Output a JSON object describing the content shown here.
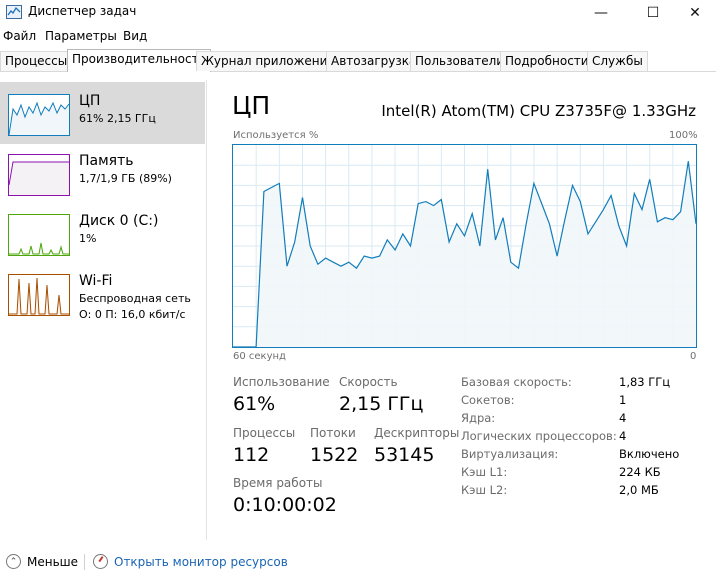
{
  "window": {
    "title": "Диспетчер задач",
    "minimize": "—",
    "maximize": "☐",
    "close": "✕"
  },
  "menu": [
    "Файл",
    "Параметры",
    "Вид"
  ],
  "tabs": [
    "Процессы",
    "Производительность",
    "Журнал приложений",
    "Автозагрузка",
    "Пользователи",
    "Подробности",
    "Службы"
  ],
  "active_tab": "Производительность",
  "sidebar": [
    {
      "title": "ЦП",
      "line1": "61% 2,15 ГГц",
      "line2": "",
      "color": "#117dbb"
    },
    {
      "title": "Память",
      "line1": "1,7/1,9 ГБ (89%)",
      "line2": "",
      "color": "#8b12ae"
    },
    {
      "title": "Диск 0 (C:)",
      "line1": "1%",
      "line2": "",
      "color": "#4da60c"
    },
    {
      "title": "Wi-Fi",
      "line1": "Беспроводная сеть",
      "line2": "О: 0 П: 16,0 кбит/с",
      "color": "#a74f01"
    }
  ],
  "main": {
    "title": "ЦП",
    "cpu_name": "Intel(R) Atom(TM) CPU Z3735F@ 1.33GHz",
    "chart_label_left": "Используется %",
    "chart_label_right": "100%",
    "axis_left": "60 секунд",
    "axis_right": "0"
  },
  "chart_data": {
    "type": "area",
    "title": "",
    "ylabel": "Используется %",
    "ymax_label": "100%",
    "xlabel_left": "60 секунд",
    "xlabel_right": "0",
    "ylim": [
      0,
      100
    ],
    "x_seconds_ago": [
      60,
      57,
      56,
      54,
      53,
      52,
      51,
      50,
      49,
      48,
      47,
      46,
      45,
      44,
      43,
      42,
      41,
      40,
      39,
      38,
      37,
      36,
      35,
      34,
      33,
      32,
      31,
      30,
      29,
      28,
      27,
      26,
      25,
      24,
      23,
      22,
      21,
      20,
      19,
      18,
      17,
      16,
      15,
      14,
      13,
      12,
      11,
      10,
      9,
      8,
      7,
      6,
      5,
      4,
      3,
      2,
      1,
      0
    ],
    "values": [
      0,
      0,
      77,
      81,
      40,
      52,
      74,
      50,
      41,
      44,
      42,
      40,
      42,
      39,
      45,
      44,
      45,
      53,
      48,
      56,
      50,
      71,
      72,
      70,
      73,
      52,
      61,
      55,
      66,
      50,
      88,
      53,
      64,
      42,
      39,
      61,
      81,
      71,
      61,
      45,
      63,
      80,
      72,
      56,
      62,
      68,
      75,
      60,
      50,
      76,
      68,
      83,
      62,
      64,
      63,
      67,
      92,
      61
    ],
    "color": "#117dbb",
    "fill": "#f1f6fa"
  },
  "stats": {
    "usage_label": "Использование",
    "usage_value": "61%",
    "speed_label": "Скорость",
    "speed_value": "2,15 ГГц",
    "processes_label": "Процессы",
    "processes_value": "112",
    "threads_label": "Потоки",
    "threads_value": "1522",
    "handles_label": "Дескрипторы",
    "handles_value": "53145",
    "uptime_label": "Время работы",
    "uptime_value": "0:10:00:02"
  },
  "specs": [
    {
      "label": "Базовая скорость:",
      "value": "1,83 ГГц"
    },
    {
      "label": "Сокетов:",
      "value": "1"
    },
    {
      "label": "Ядра:",
      "value": "4"
    },
    {
      "label": "Логических процессоров:",
      "value": "4"
    },
    {
      "label": "Виртуализация:",
      "value": "Включено"
    },
    {
      "label": "Кэш L1:",
      "value": "224 КБ"
    },
    {
      "label": "Кэш L2:",
      "value": "2,0 МБ"
    }
  ],
  "footer": {
    "less": "Меньше",
    "resource_monitor": "Открыть монитор ресурсов"
  }
}
